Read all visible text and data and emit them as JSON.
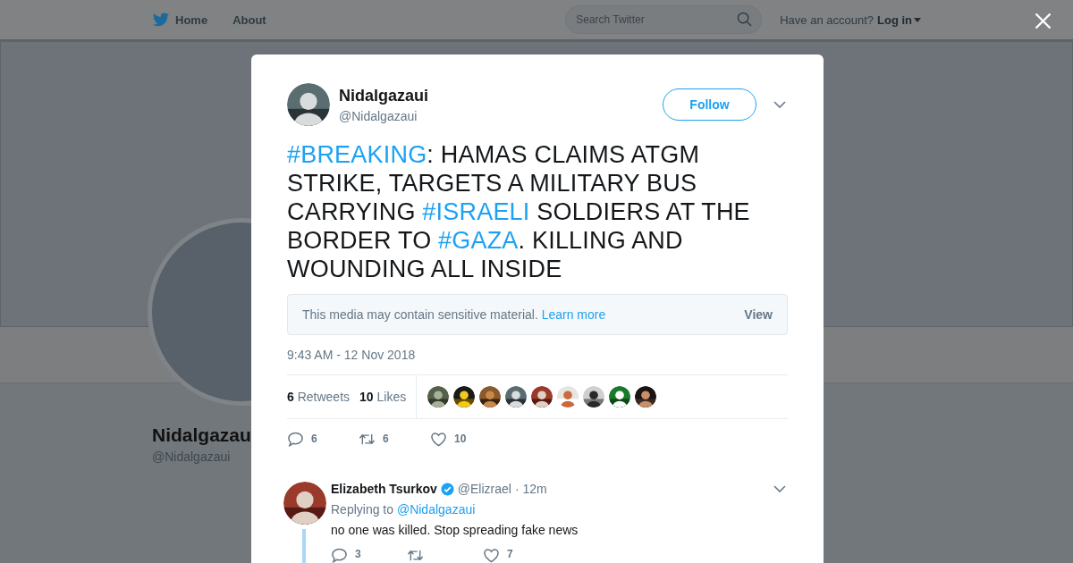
{
  "top_bar": {
    "nav": [
      {
        "label": "Home",
        "kind": "home"
      },
      {
        "label": "About",
        "kind": "plain"
      }
    ],
    "search": {
      "placeholder": "Search Twitter"
    },
    "account_prompt": "Have an account?",
    "login": "Log in"
  },
  "profile": {
    "name": "Nidalgazau",
    "handle": "@Nidalgazaui"
  },
  "tweet": {
    "author": {
      "name": "Nidalgazaui",
      "handle": "@Nidalgazaui"
    },
    "follow_button": "Follow",
    "text": [
      {
        "kind": "hashtag",
        "text": "#BREAKING"
      },
      {
        "kind": "plain",
        "text": ": HAMAS CLAIMS ATGM STRIKE, TARGETS A MILITARY BUS CARRYING "
      },
      {
        "kind": "hashtag",
        "text": "#ISRAELI"
      },
      {
        "kind": "plain",
        "text": " SOLDIERS AT THE BORDER TO "
      },
      {
        "kind": "hashtag",
        "text": "#GAZA"
      },
      {
        "kind": "plain",
        "text": ". KILLING AND WOUNDING ALL INSIDE"
      }
    ],
    "sensitive_notice": {
      "message": "This media may contain sensitive material.",
      "link": "Learn more",
      "button": "View"
    },
    "timestamp": "9:43 AM - 12 Nov 2018",
    "stats": [
      {
        "count": "6",
        "label": "Retweets"
      },
      {
        "count": "10",
        "label": "Likes"
      }
    ],
    "actions": [
      {
        "kind": "reply",
        "count": "6"
      },
      {
        "kind": "retweet",
        "count": "6"
      },
      {
        "kind": "like",
        "count": "10"
      }
    ]
  },
  "reply": {
    "name": "Elizabeth Tsurkov",
    "verified": true,
    "handle": "@Elizrael",
    "time": "· 12m",
    "replying_label": "Replying to",
    "replying_to": "@Nidalgazaui",
    "text": "no one was killed. Stop spreading fake news",
    "actions": [
      {
        "kind": "reply",
        "count": "3"
      },
      {
        "kind": "retweet"
      },
      {
        "kind": "like",
        "count": "7"
      }
    ]
  }
}
